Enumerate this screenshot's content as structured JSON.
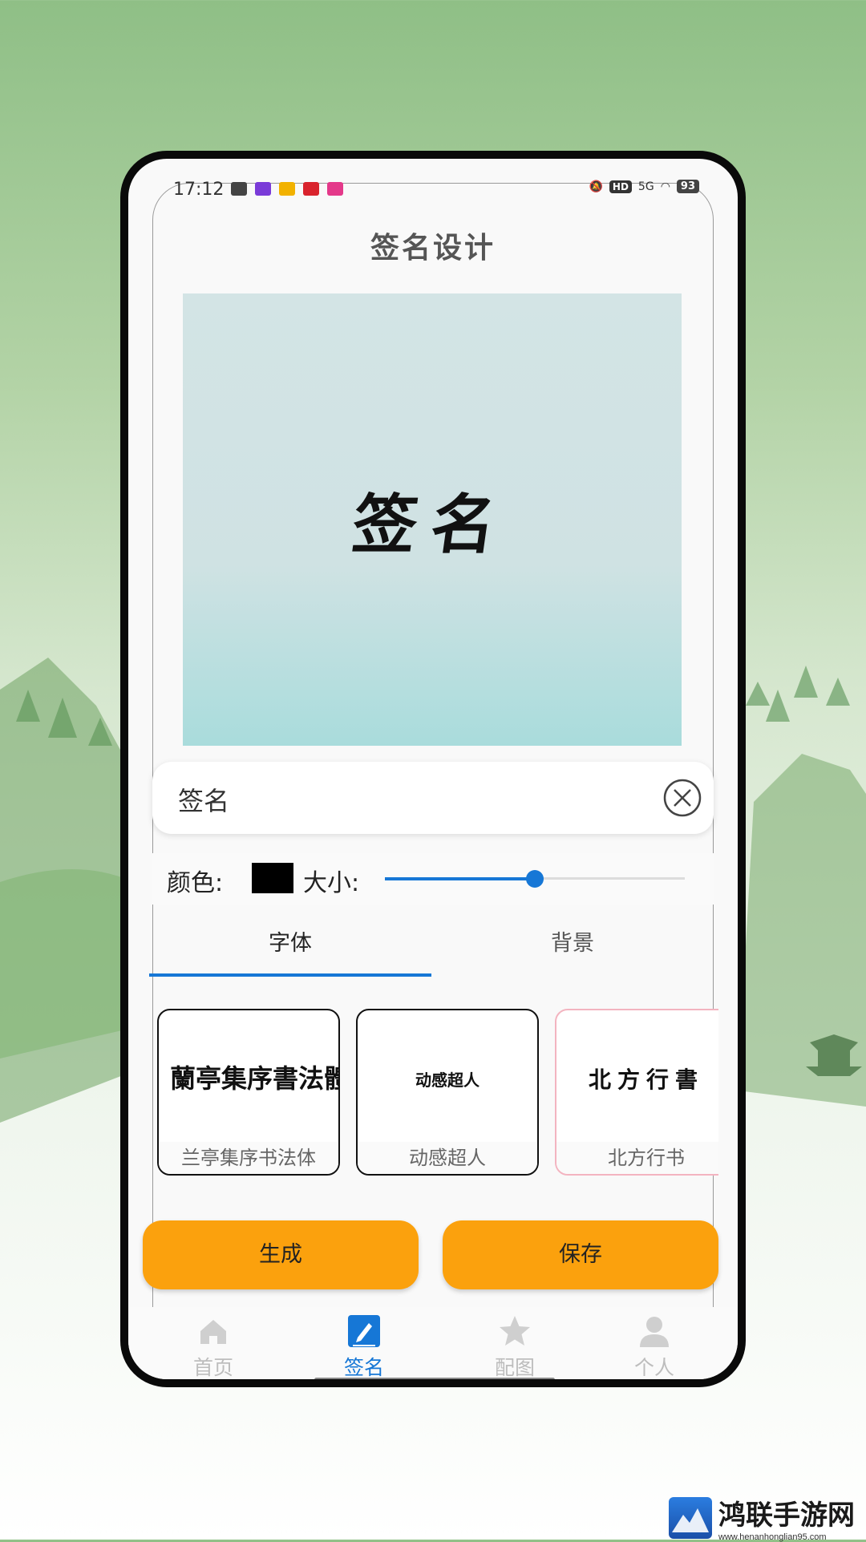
{
  "status_bar": {
    "time": "17:12",
    "signal_text": "5G",
    "battery": "93"
  },
  "page_title": "签名设计",
  "preview": {
    "text": "签名"
  },
  "name_input": {
    "value": "签名"
  },
  "controls": {
    "color_label": "颜色:",
    "color_value": "#000000",
    "size_label": "大小:",
    "size_level": 0.5
  },
  "tabs": [
    {
      "label": "字体",
      "active": true
    },
    {
      "label": "背景",
      "active": false
    }
  ],
  "font_options": [
    {
      "sample": "蘭亭集序書法體",
      "name": "兰亭集序书法体"
    },
    {
      "sample": "动感超人",
      "name": "动感超人"
    },
    {
      "sample": "北方行書",
      "name": "北方行书"
    }
  ],
  "actions": {
    "generate": "生成",
    "save": "保存"
  },
  "bottom_nav": [
    {
      "label": "首页",
      "icon": "home-icon",
      "active": false
    },
    {
      "label": "签名",
      "icon": "signature-edit-icon",
      "active": true
    },
    {
      "label": "配图",
      "icon": "star-icon",
      "active": false
    },
    {
      "label": "个人",
      "icon": "person-icon",
      "active": false
    }
  ],
  "watermark": {
    "title": "鸿联手游网",
    "url": "www.henanhonglian95.com"
  },
  "colors": {
    "accent": "#1677d6",
    "button": "#fba10d",
    "preview_top": "#d3e4e5",
    "preview_bottom": "#a9dcdc"
  }
}
